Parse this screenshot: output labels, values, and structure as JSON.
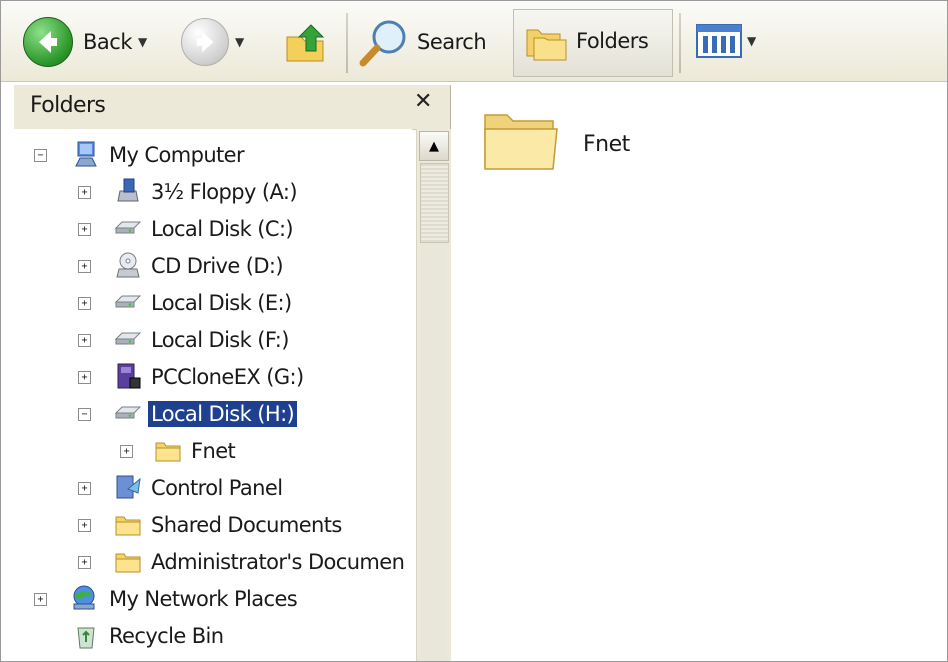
{
  "toolbar": {
    "back_label": "Back",
    "search_label": "Search",
    "folders_label": "Folders"
  },
  "left_pane": {
    "title": "Folders",
    "close_glyph": "✕"
  },
  "tree": [
    {
      "label": "My Computer",
      "icon": "my-computer-icon",
      "expander": "−"
    },
    {
      "label": "3½ Floppy (A:)",
      "icon": "floppy-drive-icon",
      "expander": "+"
    },
    {
      "label": "Local Disk (C:)",
      "icon": "hard-disk-icon",
      "expander": "+"
    },
    {
      "label": "CD Drive (D:)",
      "icon": "cd-drive-icon",
      "expander": "+"
    },
    {
      "label": "Local Disk (E:)",
      "icon": "hard-disk-icon",
      "expander": "+"
    },
    {
      "label": "Local Disk (F:)",
      "icon": "hard-disk-icon",
      "expander": "+"
    },
    {
      "label": "PCCloneEX (G:)",
      "icon": "pcclone-drive-icon",
      "expander": "+"
    },
    {
      "label": "Local Disk (H:)",
      "icon": "hard-disk-icon",
      "expander": "−",
      "selected": true
    },
    {
      "label": "Fnet",
      "icon": "folder-icon",
      "expander": "+"
    },
    {
      "label": "Control Panel",
      "icon": "control-panel-icon",
      "expander": "+"
    },
    {
      "label": "Shared Documents",
      "icon": "folder-icon",
      "expander": "+"
    },
    {
      "label": "Administrator's Documen",
      "icon": "folder-icon",
      "expander": "+"
    },
    {
      "label": "My Network Places",
      "icon": "network-places-icon",
      "expander": "+"
    },
    {
      "label": "Recycle Bin",
      "icon": "recycle-bin-icon",
      "expander": ""
    }
  ],
  "content": {
    "items": [
      {
        "name": "Fnet",
        "icon": "folder-icon"
      }
    ]
  },
  "colors": {
    "selection": "#1f3f8f",
    "toolbar_bg": "#ece9d8"
  }
}
